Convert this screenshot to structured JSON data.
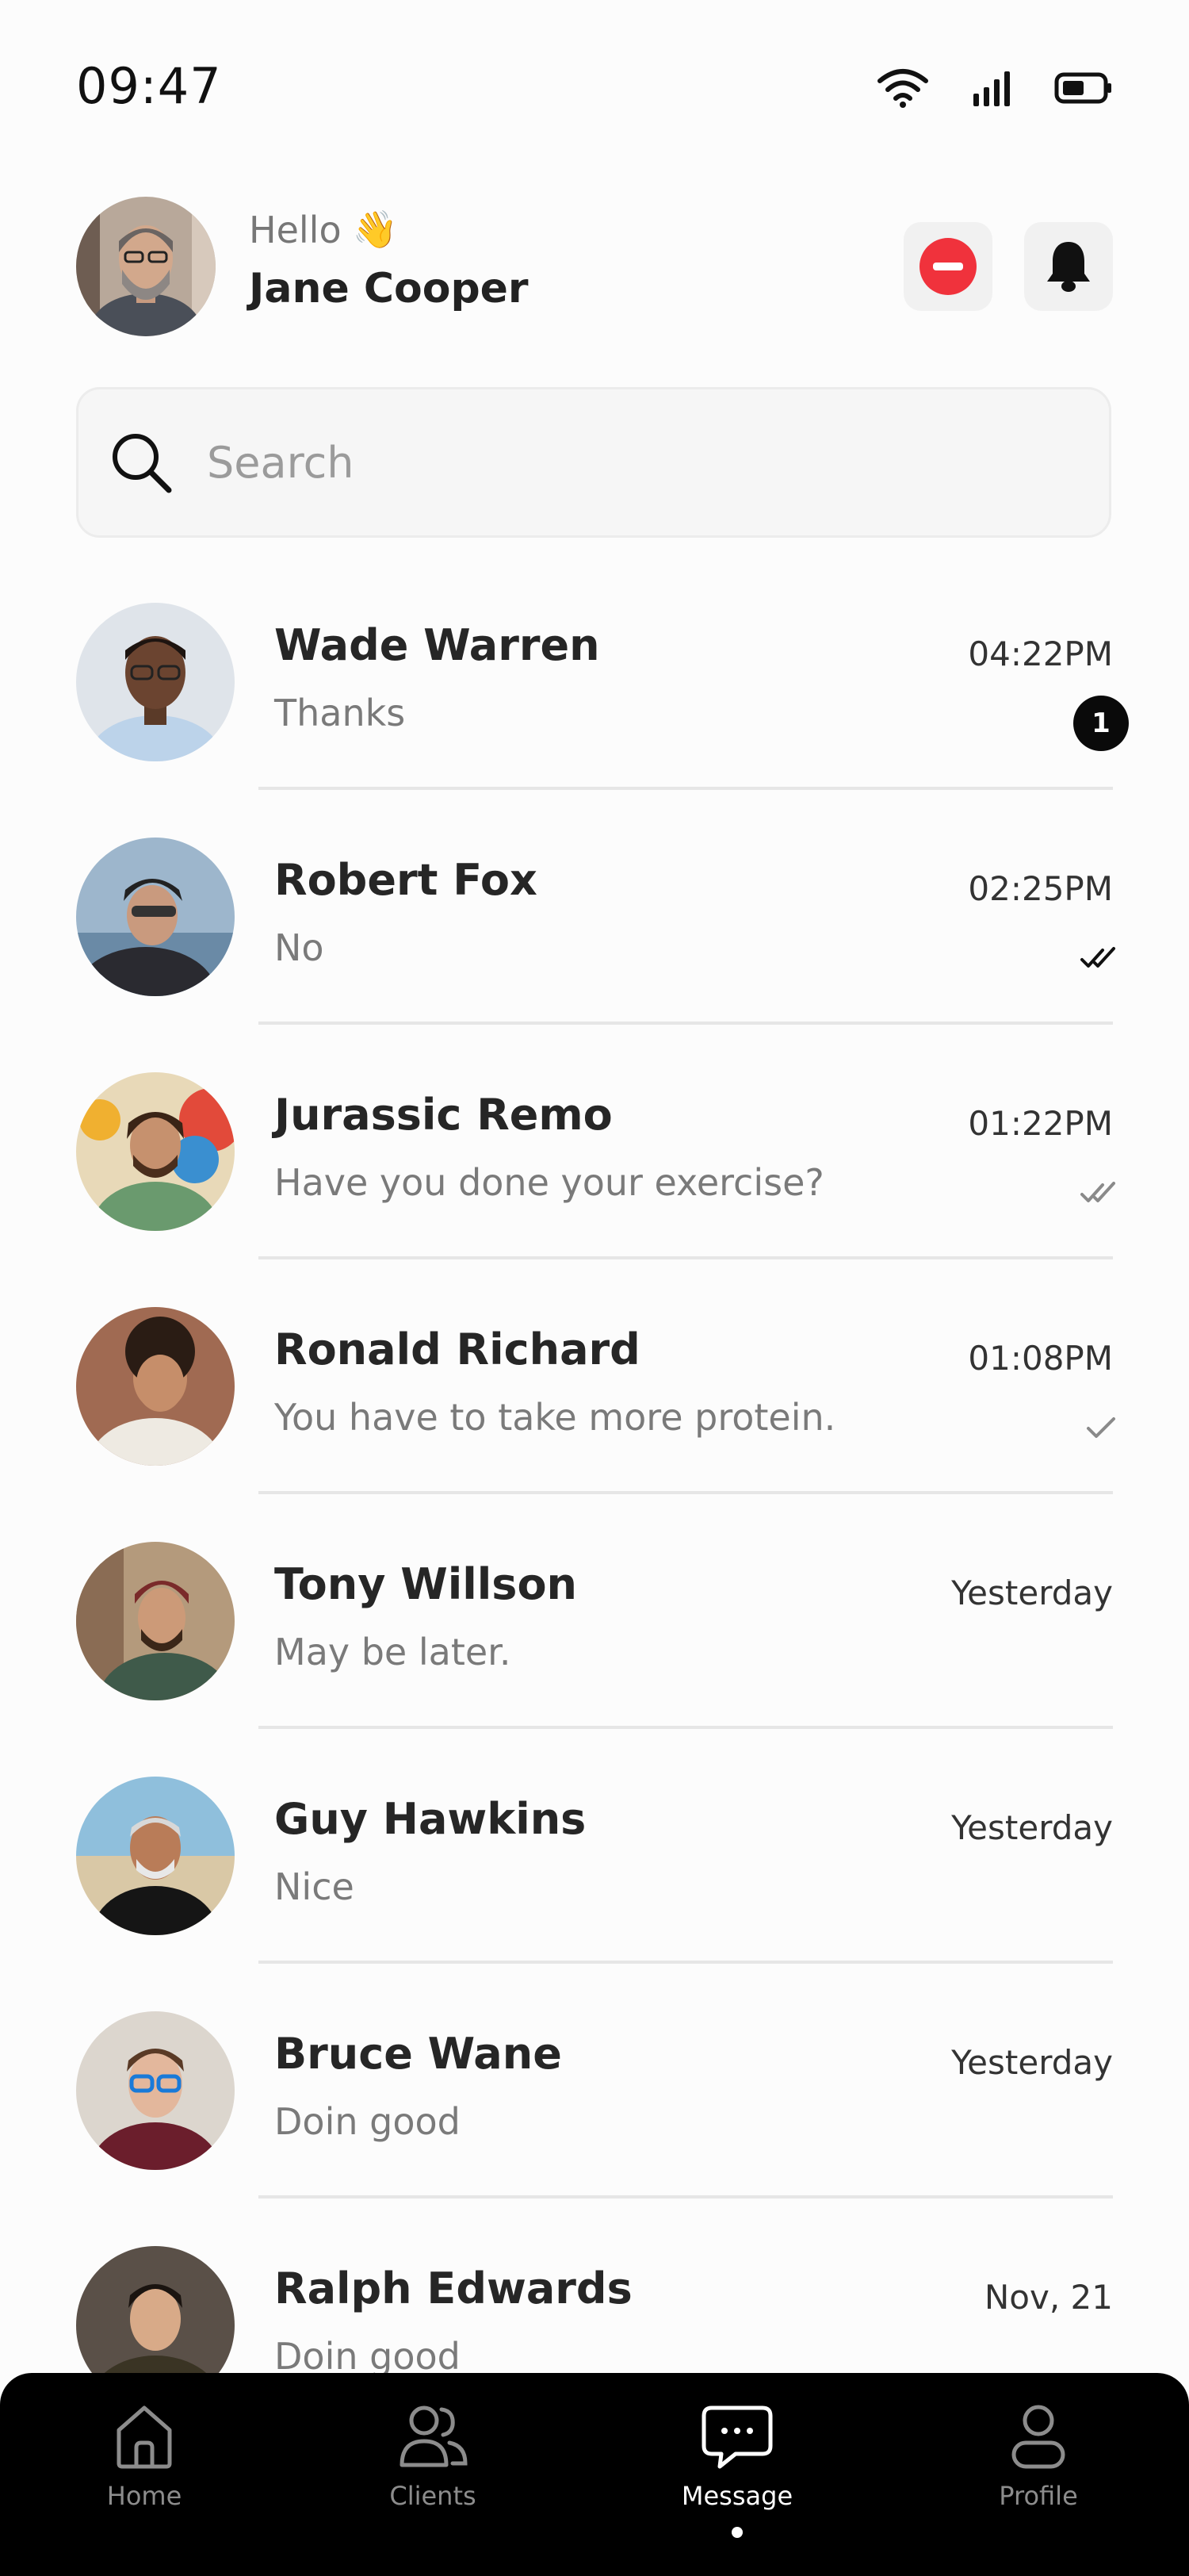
{
  "status_bar": {
    "time": "09:47",
    "icons": [
      "wifi-icon",
      "signal-icon",
      "battery-icon"
    ]
  },
  "header": {
    "greeting": "Hello",
    "greeting_emoji": "👋",
    "user_name": "Jane Cooper",
    "buttons": [
      {
        "icon": "do-not-disturb-icon",
        "color": "#f0323c"
      },
      {
        "icon": "bell-icon"
      }
    ]
  },
  "search": {
    "placeholder": "Search"
  },
  "chats": [
    {
      "name": "Wade Warren",
      "message": "Thanks",
      "time": "04:22PM",
      "status": "unread",
      "unread_count": "1"
    },
    {
      "name": "Robert Fox",
      "message": "No",
      "time": "02:25PM",
      "status": "read"
    },
    {
      "name": "Jurassic Remo",
      "message": "Have you done your exercise?",
      "time": "01:22PM",
      "status": "delivered"
    },
    {
      "name": "Ronald Richard",
      "message": "You have to take more protein.",
      "time": "01:08PM",
      "status": "sent"
    },
    {
      "name": "Tony Willson",
      "message": "May be later.",
      "time": "Yesterday",
      "status": "none"
    },
    {
      "name": "Guy Hawkins",
      "message": "Nice",
      "time": "Yesterday",
      "status": "none"
    },
    {
      "name": "Bruce Wane",
      "message": "Doin good",
      "time": "Yesterday",
      "status": "none"
    },
    {
      "name": "Ralph Edwards",
      "message": "Doin good",
      "time": "Nov, 21",
      "status": "none"
    }
  ],
  "bottom_nav": {
    "items": [
      {
        "label": "Home",
        "icon": "home-icon"
      },
      {
        "label": "Clients",
        "icon": "clients-icon"
      },
      {
        "label": "Message",
        "icon": "message-icon",
        "active": true
      },
      {
        "label": "Profile",
        "icon": "profile-icon"
      }
    ]
  },
  "colors": {
    "background": "#fcfcfc",
    "nav_background": "#000000",
    "accent_red": "#f0323c"
  }
}
